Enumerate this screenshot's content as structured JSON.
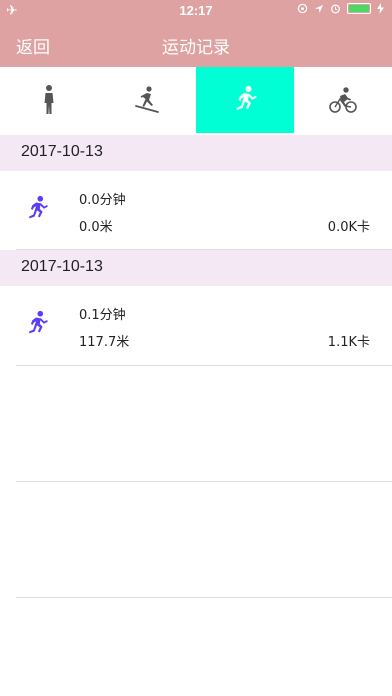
{
  "status_bar": {
    "time": "12:17",
    "icons": [
      "airplane-icon",
      "lock-rotation-icon",
      "location-icon",
      "alarm-icon",
      "battery-icon",
      "charging-icon"
    ],
    "battery_color": "#4cd964"
  },
  "nav": {
    "back_label": "返回",
    "title": "运动记录",
    "background": "#dfa2a2"
  },
  "tabs": [
    {
      "icon": "walk-icon",
      "active": false
    },
    {
      "icon": "ski-icon",
      "active": false
    },
    {
      "icon": "run-icon",
      "active": true
    },
    {
      "icon": "bike-icon",
      "active": false
    }
  ],
  "active_tab_color": "#00ffd4",
  "records": [
    {
      "date": "2017-10-13",
      "duration": "0.0分钟",
      "distance": "0.0米",
      "calories": "0.0K卡",
      "icon": "run-icon"
    },
    {
      "date": "2017-10-13",
      "duration": "0.1分钟",
      "distance": "117.7米",
      "calories": "1.1K卡",
      "icon": "run-icon"
    }
  ]
}
